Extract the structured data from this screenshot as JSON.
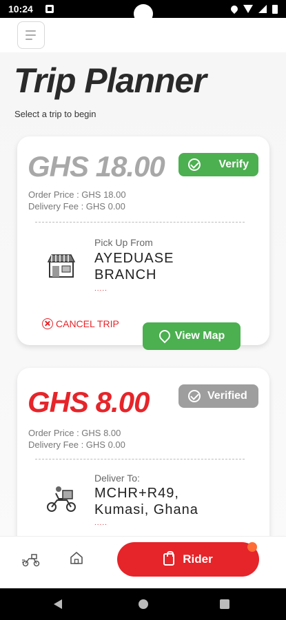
{
  "status_bar": {
    "time": "10:24"
  },
  "header": {
    "menu_icon": "hamburger-icon",
    "title": "Trip Planner",
    "subtitle": "Select a trip to begin"
  },
  "trips": [
    {
      "price": "GHS 18.00",
      "status_label": "Verify",
      "order_price": "Order Price   : GHS 18.00",
      "delivery_fee": "Delivery Fee : GHS 0.00",
      "location_label": "Pick Up From",
      "location_name": "AYEDUASE BRANCH",
      "dots": ".....",
      "cancel_label": "CANCEL TRIP",
      "map_label": "View Map",
      "icon": "storefront-icon",
      "price_color": "#a8a8a8",
      "status_color": "#4caf50"
    },
    {
      "price": "GHS 8.00",
      "status_label": "Verified",
      "order_price": "Order Price   : GHS 8.00",
      "delivery_fee": "Delivery Fee : GHS 0.00",
      "location_label": "Deliver To:",
      "location_name": "MCHR+R49, Kumasi, Ghana",
      "dots": ".....",
      "icon": "delivery-scooter-icon",
      "price_color": "#e5252a",
      "status_color": "#9e9e9e"
    }
  ],
  "bottom_nav": {
    "rider_label": "Rider",
    "items": [
      "delivery-bike-icon",
      "home-icon",
      "shopping-bag-icon"
    ]
  },
  "colors": {
    "accent_red": "#e5252a",
    "accent_green": "#4caf50",
    "notification_dot": "#ff6b35"
  }
}
